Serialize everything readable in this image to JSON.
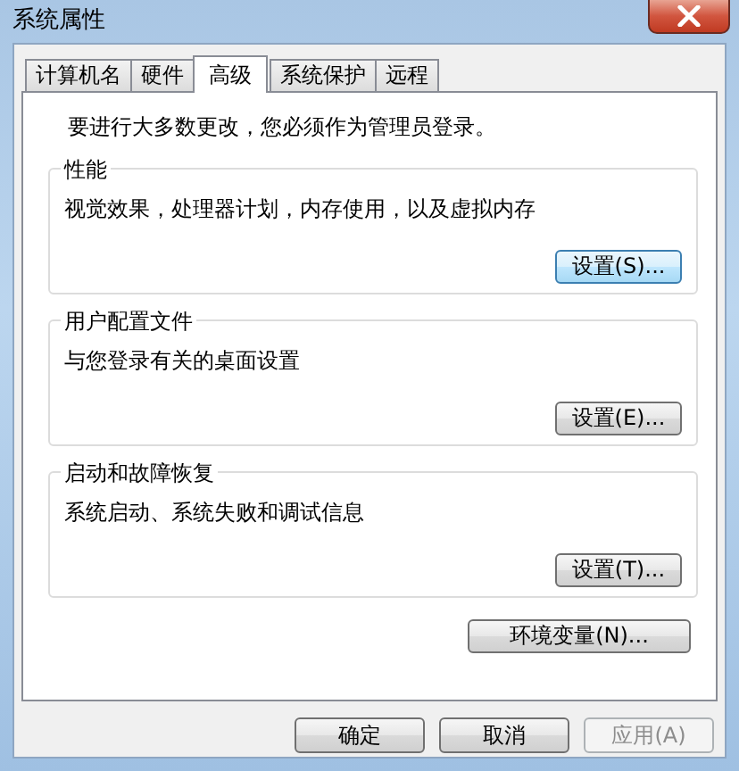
{
  "window": {
    "title": "系统属性"
  },
  "tabs": [
    {
      "label": "计算机名",
      "selected": false
    },
    {
      "label": "硬件",
      "selected": false
    },
    {
      "label": "高级",
      "selected": true
    },
    {
      "label": "系统保护",
      "selected": false
    },
    {
      "label": "远程",
      "selected": false
    }
  ],
  "notice": "要进行大多数更改，您必须作为管理员登录。",
  "groups": [
    {
      "title": "性能",
      "description": "视觉效果，处理器计划，内存使用，以及虚拟内存",
      "button": "设置(S)...",
      "focused": true
    },
    {
      "title": "用户配置文件",
      "description": "与您登录有关的桌面设置",
      "button": "设置(E)...",
      "focused": false
    },
    {
      "title": "启动和故障恢复",
      "description": "系统启动、系统失败和调试信息",
      "button": "设置(T)...",
      "focused": false
    }
  ],
  "env_button": "环境变量(N)...",
  "buttons": [
    {
      "label": "确定",
      "disabled": false
    },
    {
      "label": "取消",
      "disabled": false
    },
    {
      "label": "应用(A)",
      "disabled": true
    }
  ]
}
